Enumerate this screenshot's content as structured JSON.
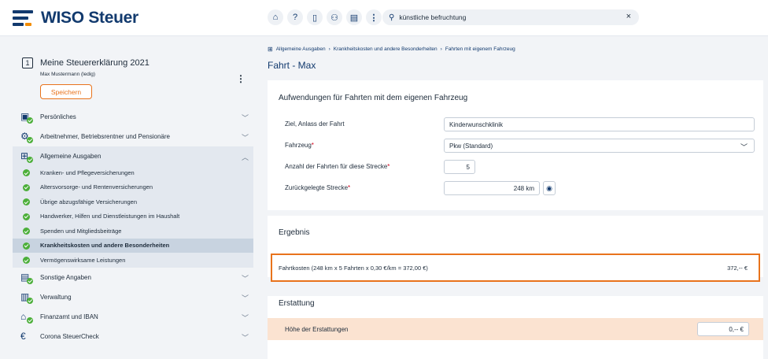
{
  "app": {
    "logo_text": "WISO Steuer"
  },
  "toolbar": {
    "icons": [
      "home-icon",
      "help-icon",
      "bookmark-icon",
      "people-icon",
      "documents-icon",
      "more-icon"
    ],
    "search_value": "künstliche befruchtung",
    "search_close": "×"
  },
  "sidebar": {
    "number": "1",
    "title": "Meine Steuererklärung 2021",
    "subtitle": "Max Mustermann (ledig)",
    "menu": "⋮",
    "save_label": "Speichern",
    "items": [
      {
        "label": "Persönliches"
      },
      {
        "label": "Arbeitnehmer, Betriebsrentner und Pensionäre"
      }
    ],
    "group": {
      "label": "Allgemeine Ausgaben",
      "children": [
        {
          "label": "Kranken- und Pflegeversicherungen"
        },
        {
          "label": "Altersvorsorge- und Rentenversicherungen"
        },
        {
          "label": "Übrige abzugsfähige Versicherungen"
        },
        {
          "label": "Handwerker, Hilfen und Dienstleistungen im Haushalt"
        },
        {
          "label": "Spenden und Mitgliedsbeiträge"
        },
        {
          "label": "Krankheitskosten und andere Besonderheiten",
          "active": true
        },
        {
          "label": "Vermögenswirksame Leistungen"
        }
      ]
    },
    "items_after": [
      {
        "label": "Sonstige Angaben"
      },
      {
        "label": "Verwaltung"
      },
      {
        "label": "Finanzamt und IBAN"
      },
      {
        "label": "Corona SteuerCheck"
      }
    ]
  },
  "main": {
    "breadcrumb": [
      "Allgemeine Ausgaben",
      "Krankheitskosten und andere Besonderheiten",
      "Fahrten mit eigenem Fahrzeug"
    ],
    "breadcrumb_sep": "›",
    "title": "Fahrt - Max",
    "section1": {
      "title": "Aufwendungen für Fahrten mit dem eigenen Fahrzeug",
      "fields": {
        "ziel_label": "Ziel, Anlass der Fahrt",
        "ziel_value": "Kinderwunschklinik",
        "fahrzeug_label": "Fahrzeug",
        "fahrzeug_value": "Pkw (Standard)",
        "anzahl_label": "Anzahl der Fahrten für diese Strecke",
        "anzahl_value": "5",
        "strecke_label": "Zurückgelegte Strecke",
        "strecke_value": "248 km"
      },
      "required_mark": "*"
    },
    "section2": {
      "title": "Ergebnis",
      "result_text": "Fahrtkosten (248 km x 5 Fahrten x 0,30 €/km = 372,00 €)",
      "result_value": "372,-- €"
    },
    "section3": {
      "title": "Erstattung",
      "refund_label": "Höhe der Erstattungen",
      "refund_value": "0,-- €"
    }
  },
  "colors": {
    "brand": "#123a6e",
    "accent": "#e8731c",
    "success": "#4caf3a",
    "highlight_row": "#fbe3d1"
  }
}
